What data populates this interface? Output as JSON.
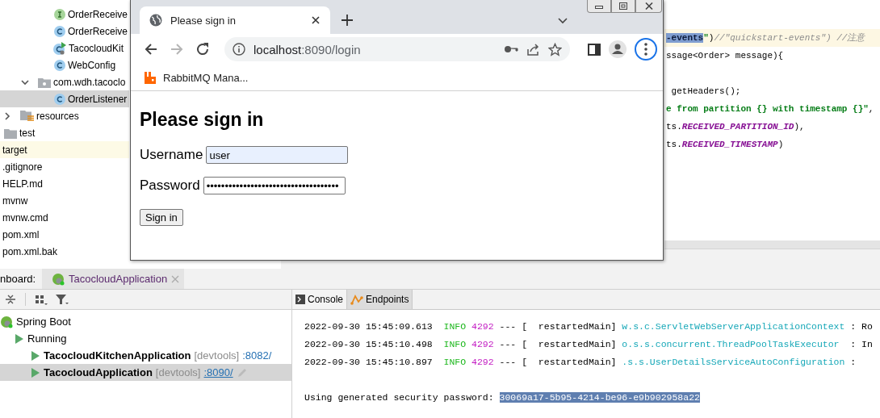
{
  "project_tree": {
    "items": [
      {
        "kind": "interface",
        "label": "OrderReceive",
        "selected": false,
        "excluded": false
      },
      {
        "kind": "class",
        "label": "OrderReceive",
        "selected": false,
        "excluded": false
      },
      {
        "kind": "app-class",
        "label": "TacocloudKit",
        "selected": false,
        "excluded": false
      },
      {
        "kind": "class",
        "label": "WebConfig",
        "selected": false,
        "excluded": false
      },
      {
        "kind": "package",
        "label": "com.wdh.tacoclo",
        "expanded": true,
        "selected": false,
        "excluded": false,
        "children": [
          {
            "kind": "class",
            "label": "OrderListener",
            "selected": true,
            "excluded": false
          }
        ]
      },
      {
        "kind": "resources-folder",
        "label": "resources",
        "expanded": false,
        "selected": false,
        "excluded": false
      },
      {
        "kind": "folder",
        "label": "test",
        "selected": false,
        "excluded": false
      },
      {
        "kind": "file",
        "label": "target",
        "selected": false,
        "excluded": true
      },
      {
        "kind": "file",
        "label": ".gitignore",
        "selected": false,
        "excluded": false
      },
      {
        "kind": "file",
        "label": "HELP.md",
        "selected": false,
        "excluded": false
      },
      {
        "kind": "file",
        "label": "mvnw",
        "selected": false,
        "excluded": false
      },
      {
        "kind": "file",
        "label": "mvnw.cmd",
        "selected": false,
        "excluded": false
      },
      {
        "kind": "file",
        "label": "pom.xml",
        "selected": false,
        "excluded": false
      },
      {
        "kind": "file",
        "label": "pom.xml.bak",
        "selected": false,
        "excluded": false
      }
    ]
  },
  "editor": {
    "lines": [
      {
        "kind": "code",
        "current": true,
        "segments": [
          {
            "text": "-events",
            "kind": "selected"
          },
          {
            "text": "\"",
            "kind": "string"
          },
          {
            "text": ")",
            "kind": "plain"
          },
          {
            "text": "//\"quickstart-events\") //注意",
            "kind": "comment"
          }
        ]
      },
      {
        "kind": "code",
        "current": false,
        "segments": [
          {
            "text": "ssage<Order> message){",
            "kind": "plain"
          }
        ]
      },
      {
        "kind": "blank"
      },
      {
        "kind": "code",
        "current": false,
        "segments": [
          {
            "text": " getHeaders();",
            "kind": "plain"
          }
        ]
      },
      {
        "kind": "code",
        "current": false,
        "segments": [
          {
            "text": "e from partition {} with timestamp {}\"",
            "kind": "string"
          },
          {
            "text": ",",
            "kind": "plain"
          }
        ]
      },
      {
        "kind": "code",
        "current": false,
        "segments": [
          {
            "text": "ts.",
            "kind": "plain"
          },
          {
            "text": "RECEIVED_PARTITION_ID",
            "kind": "constant"
          },
          {
            "text": "),",
            "kind": "plain"
          }
        ]
      },
      {
        "kind": "code",
        "current": false,
        "segments": [
          {
            "text": "ts.",
            "kind": "plain"
          },
          {
            "text": "RECEIVED_TIMESTAMP",
            "kind": "constant"
          },
          {
            "text": ")",
            "kind": "plain"
          }
        ]
      }
    ]
  },
  "dashboard": {
    "title_partial": "nboard:",
    "tabs": [
      {
        "title": "TacocloudApplication",
        "selected": true
      }
    ],
    "tree": [
      {
        "kind": "group",
        "label": "Spring Boot",
        "selected": false,
        "children": [
          {
            "kind": "status",
            "label": "Running",
            "selected": false,
            "children": [
              {
                "kind": "app",
                "label": "TacocloudKitchenApplication",
                "tag": "[devtools]",
                "port": ":8082/",
                "selected": false
              },
              {
                "kind": "app",
                "label": "TacocloudApplication",
                "tag": "[devtools]",
                "port": ":8090/",
                "selected": true
              }
            ]
          }
        ]
      }
    ]
  },
  "console": {
    "tabs": [
      {
        "label": "Console",
        "selected": true
      },
      {
        "label": "Endpoints",
        "selected": false
      }
    ],
    "lines": [
      {
        "kind": "log",
        "timestamp": "2022-09-30 15:45:09.613",
        "level": "INFO",
        "pid": "4292",
        "thread": "--- [  restartedMain]",
        "logger": "w.s.c.ServletWebServerApplicationContext",
        "message": ": Ro"
      },
      {
        "kind": "log",
        "timestamp": "2022-09-30 15:45:10.498",
        "level": "INFO",
        "pid": "4292",
        "thread": "--- [  restartedMain]",
        "logger": "o.s.s.concurrent.ThreadPoolTaskExecutor",
        "message": ": In"
      },
      {
        "kind": "log",
        "timestamp": "2022-09-30 15:45:10.897",
        "level": "INFO",
        "pid": "4292",
        "thread": "--- [  restartedMain]",
        "logger": ".s.s.UserDetailsServiceAutoConfiguration",
        "message": ":"
      },
      {
        "kind": "blank"
      },
      {
        "kind": "password",
        "text": "Using generated security password:",
        "value": "30069a17-5b95-4214-be96-e9b902958a22"
      }
    ]
  },
  "browser": {
    "tabs": [
      {
        "title": "Please sign in",
        "selected": true
      }
    ],
    "nav": {
      "back_disabled": false,
      "forward_disabled": true
    },
    "address": {
      "host": "localhost",
      "path": ":8090/login"
    },
    "menu_focused": true,
    "bookmarks": [
      {
        "label": "RabbitMQ Mana..."
      }
    ],
    "page": {
      "heading": "Please sign in",
      "fields": [
        {
          "label": "Username",
          "value": "user",
          "autofilled": true
        },
        {
          "label": "Password",
          "value": "••••••••••••••••••••••••••••••••••••",
          "autofilled": false
        }
      ],
      "submit": "Sign in"
    }
  }
}
